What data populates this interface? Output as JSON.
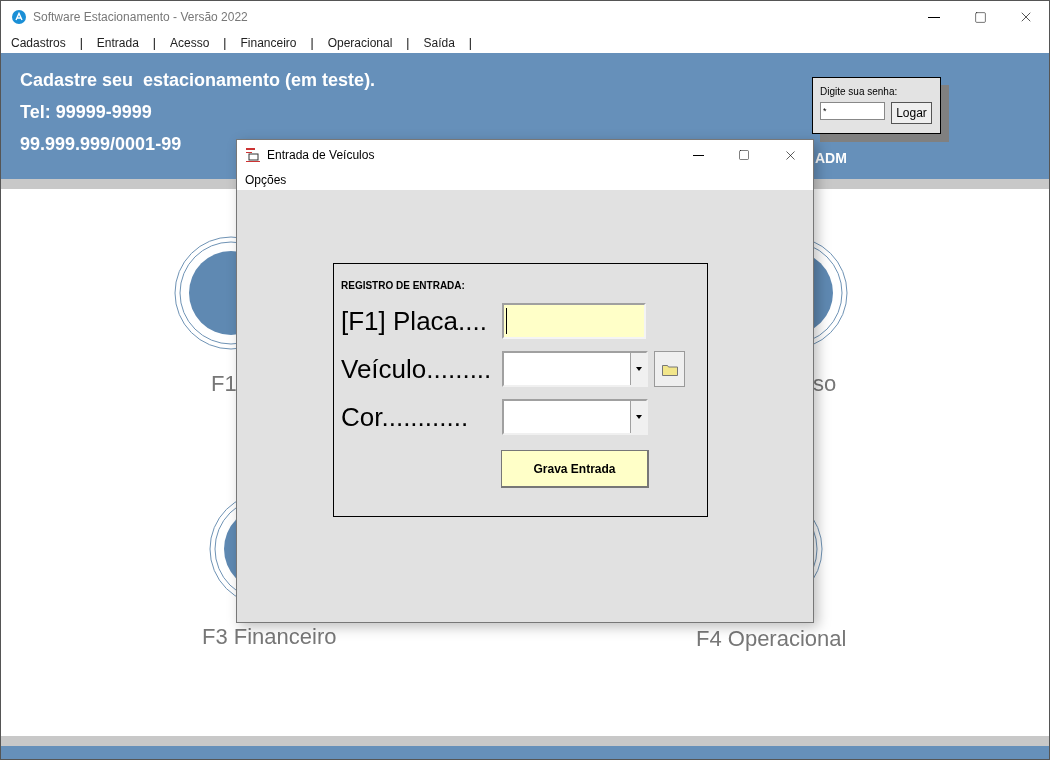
{
  "window": {
    "title": "Software Estacionamento - Versão 2022"
  },
  "menu": [
    {
      "kind": "item",
      "label": "Cadastros"
    },
    {
      "kind": "separator",
      "label": "|"
    },
    {
      "kind": "item",
      "label": "Entrada"
    },
    {
      "kind": "separator",
      "label": "|"
    },
    {
      "kind": "item",
      "label": "Acesso"
    },
    {
      "kind": "separator",
      "label": "|"
    },
    {
      "kind": "item",
      "label": "Financeiro"
    },
    {
      "kind": "separator",
      "label": "|"
    },
    {
      "kind": "item",
      "label": "Operacional"
    },
    {
      "kind": "separator",
      "label": "|"
    },
    {
      "kind": "item",
      "label": "Saída"
    },
    {
      "kind": "separator",
      "label": "|"
    }
  ],
  "header": {
    "lines": [
      "Cadastre seu  estacionamento (em teste).",
      "Tel: 99999-9999",
      "99.999.999/0001-99"
    ],
    "user": "ADM"
  },
  "login": {
    "label": "Digite sua senha:",
    "value": "*",
    "button": "Logar"
  },
  "tiles": [
    {
      "label": "F1"
    },
    {
      "label": "so"
    },
    {
      "label": "F3 Financeiro"
    },
    {
      "label": "F4 Operacional"
    }
  ],
  "dialog": {
    "title": "Entrada de Veículos",
    "menu": [
      "Opções"
    ],
    "group_title": "REGISTRO DE ENTRADA:",
    "fields": [
      {
        "kind": "text",
        "label": "[F1] Placa....",
        "focused": true
      },
      {
        "kind": "combo",
        "label": "Veículo.........",
        "browse_button": true
      },
      {
        "kind": "combo",
        "label": "Cor............"
      }
    ],
    "button": "Grava Entrada"
  }
}
